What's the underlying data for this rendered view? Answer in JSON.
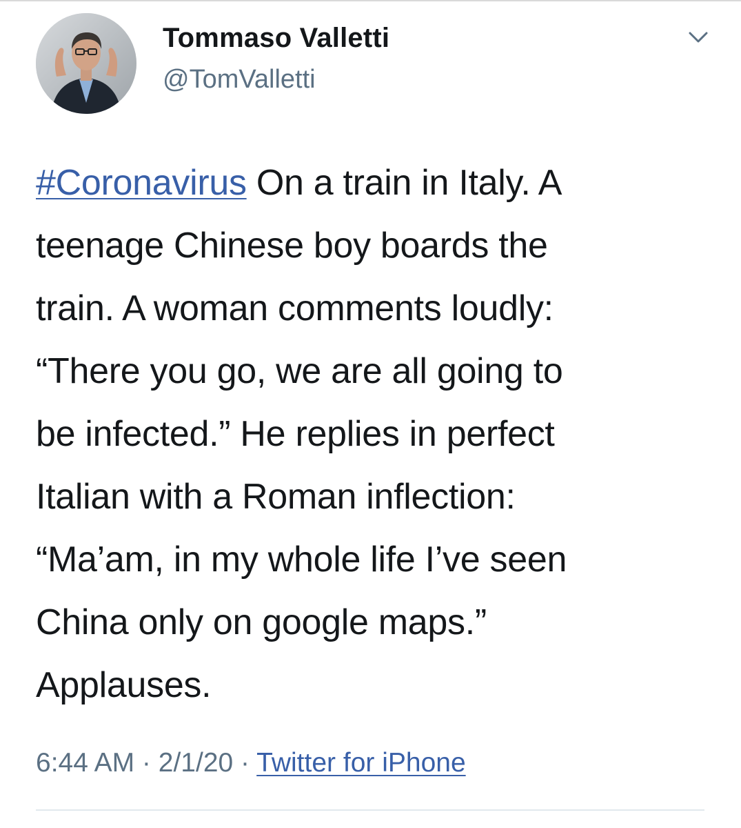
{
  "author": {
    "display_name": "Tommaso Valletti",
    "handle": "@TomValletti",
    "avatar_icon": "profile-photo"
  },
  "menu": {
    "icon": "chevron-down-icon"
  },
  "tweet": {
    "hashtag": "#Coronavirus",
    "lines": [
      " On a train in Italy. A",
      "teenage Chinese boy boards the",
      "train. A woman comments loudly:",
      "“There you go, we are all going to",
      "be infected.” He replies in perfect",
      "Italian with a Roman inflection:",
      "“Ma’am, in my whole life I’ve seen",
      "China only on google maps.”",
      "Applauses."
    ]
  },
  "meta": {
    "time": "6:44 AM",
    "separator": " · ",
    "date": "2/1/20",
    "source": "Twitter for iPhone"
  },
  "colors": {
    "link": "#385fa8",
    "secondary_text": "#5b7083",
    "primary_text": "#14171a"
  }
}
